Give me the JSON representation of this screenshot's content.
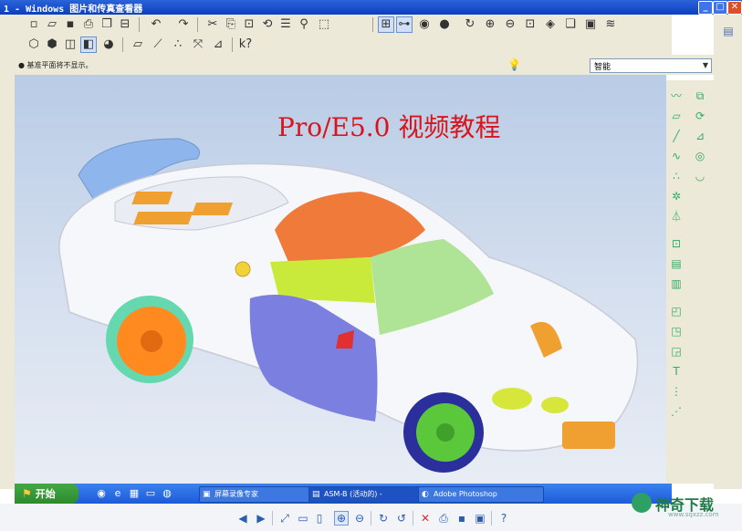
{
  "window": {
    "title": "1 - Windows 图片和传真查看器",
    "buttons": [
      "minimize",
      "maximize",
      "close"
    ]
  },
  "toolbar_row1": {
    "icons": [
      "new-file-icon",
      "open-icon",
      "save-icon",
      "print-icon",
      "copy-icon",
      "paste-icon",
      "undo-icon",
      "redo-icon",
      "cut-icon",
      "copy2-icon",
      "paste2-icon",
      "regen-icon",
      "layers-icon",
      "binoculars-icon",
      "select-icon",
      "repaint-icon",
      "orient-icon",
      "shade-icon",
      "rotate-icon",
      "zoom-in-icon",
      "zoom-out-icon",
      "refit-icon",
      "view-icon",
      "list-icon"
    ]
  },
  "toolbar_row2": {
    "icons": [
      "wireframe-icon",
      "hidden-icon",
      "no-hidden-icon",
      "shading-icon",
      "enhanced-icon",
      "datum-plane-icon",
      "datum-axis-icon",
      "datum-point-icon",
      "csys-icon",
      "annotation-icon",
      "help-icon"
    ]
  },
  "message": {
    "text": "● 基准平面将不显示。"
  },
  "filter": {
    "value": "智能"
  },
  "viewport": {
    "overlay_title": "Pro/E5.0 视频教程"
  },
  "taskbar": {
    "start_label": "开始",
    "tasks": [
      {
        "label": "屏幕录像专家"
      },
      {
        "label": "ASM-B (活动的) -"
      },
      {
        "label": "Adobe Photoshop"
      }
    ]
  },
  "logo": {
    "text": "神奇下载",
    "url": "www.sqxzz.com"
  },
  "colors": {
    "title_bar": "#0a3fc0",
    "overlay_title": "#d9141a",
    "taskbar": "#1d5ad8",
    "start_button": "#2d8a2d"
  }
}
